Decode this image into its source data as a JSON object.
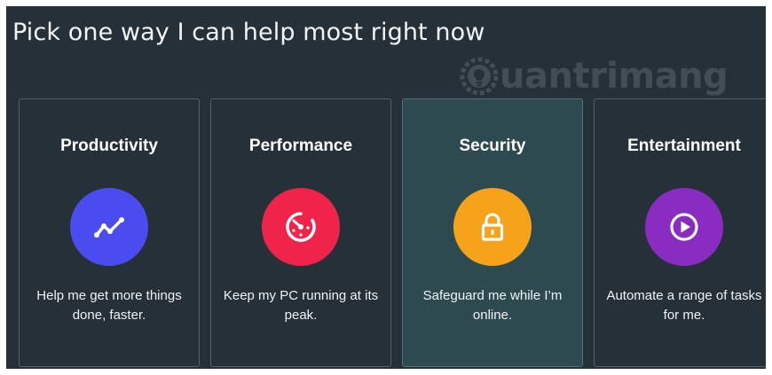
{
  "heading": "Pick one way I can help most right now",
  "watermark": {
    "text": "uantrimang",
    "icon": "lightbulb-gear-icon"
  },
  "colors": {
    "background": "#263038",
    "selected_card": "#2d4a50",
    "productivity": "#4a4cf0",
    "performance": "#f0244a",
    "security": "#f7a21b",
    "entertainment": "#8a2bc2"
  },
  "cards": [
    {
      "title": "Productivity",
      "description": "Help me get more things done, faster.",
      "icon": "trend-line-icon",
      "color": "#4a4cf0",
      "selected": false
    },
    {
      "title": "Performance",
      "description": "Keep my PC running at its peak.",
      "icon": "speed-gauge-icon",
      "color": "#f0244a",
      "selected": false
    },
    {
      "title": "Security",
      "description": "Safeguard me while I’m online.",
      "icon": "lock-icon",
      "color": "#f7a21b",
      "selected": true
    },
    {
      "title": "Entertainment",
      "description": "Automate a range of tasks for me.",
      "icon": "play-icon",
      "color": "#8a2bc2",
      "selected": false
    }
  ]
}
